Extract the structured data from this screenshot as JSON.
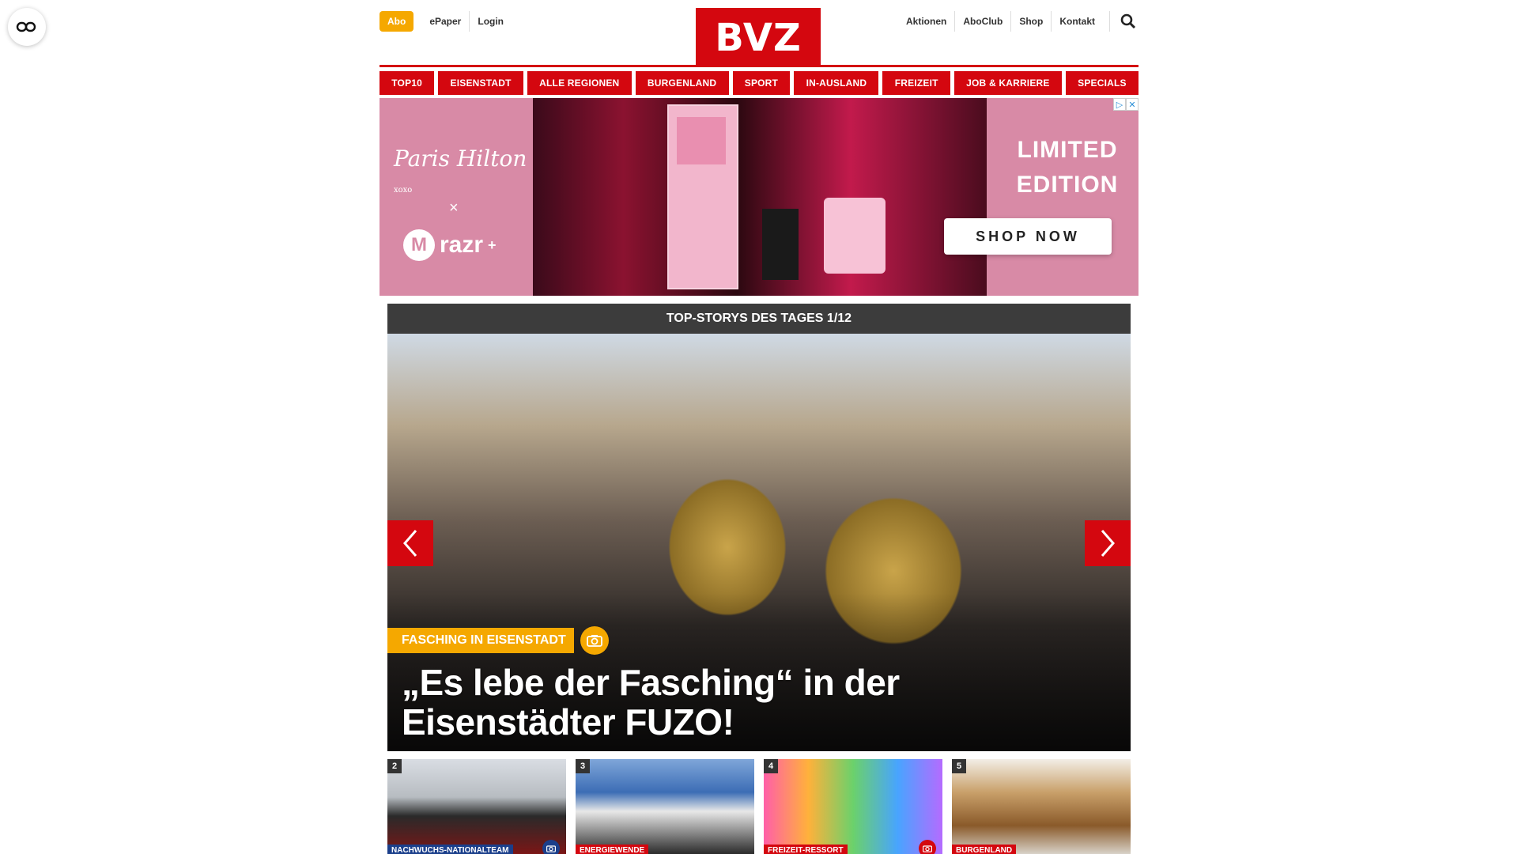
{
  "header": {
    "abo_label": "Abo",
    "left_links": [
      "ePaper",
      "Login"
    ],
    "logo_text": "BVZ",
    "right_links": [
      "Aktionen",
      "AboClub",
      "Shop",
      "Kontakt"
    ]
  },
  "nav": {
    "items": [
      "TOP10",
      "EISENSTADT",
      "ALLE REGIONEN",
      "BURGENLAND",
      "SPORT",
      "IN-AUSLAND",
      "FREIZEIT",
      "JOB & KARRIERE",
      "SPECIALS"
    ]
  },
  "ad": {
    "brand_left": "Paris Hilton",
    "brand_small": "xoxo",
    "times": "×",
    "brand_moto": "razr",
    "brand_moto_plus": "+",
    "headline_1": "LIMITED",
    "headline_2": "EDITION",
    "cta": "SHOP NOW"
  },
  "stories": {
    "header": "TOP-STORYS DES TAGES 1/12",
    "hero": {
      "category": "FASCHING IN EISENSTADT",
      "title": "„Es lebe der Fasching“ in der Eisenstädter FUZO!"
    },
    "thumbs": [
      {
        "num": "2",
        "category": "NACHWUCHS-NATIONALTEAM",
        "has_camera": true
      },
      {
        "num": "3",
        "category": "ENERGIEWENDE",
        "has_camera": false
      },
      {
        "num": "4",
        "category": "FREIZEIT-RESSORT",
        "has_camera": true
      },
      {
        "num": "5",
        "category": "BURGENLAND",
        "has_camera": false
      }
    ]
  },
  "colors": {
    "brand_red": "#d4070f",
    "accent_yellow": "#f5a800",
    "dark_header": "#3c3c3c"
  },
  "icons": [
    "reader-mode-icon",
    "search-icon",
    "chevron-left-icon",
    "chevron-right-icon",
    "camera-icon"
  ]
}
